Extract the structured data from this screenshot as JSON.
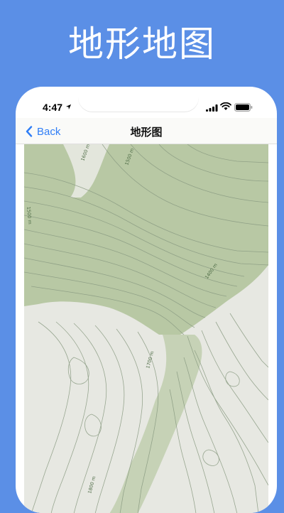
{
  "headline": "地形地图",
  "status_bar": {
    "time": "4:47"
  },
  "nav": {
    "back_label": "Back",
    "title": "地形图"
  },
  "map": {
    "contour_labels": [
      "1600 m",
      "1500 m",
      "1500 m",
      "1400 m",
      "1700 m",
      "1800 m"
    ]
  },
  "colors": {
    "background": "#5b8fe6",
    "accent": "#2f7df6",
    "vegetation": "#b9c9a6",
    "contour": "#8a9b82"
  }
}
